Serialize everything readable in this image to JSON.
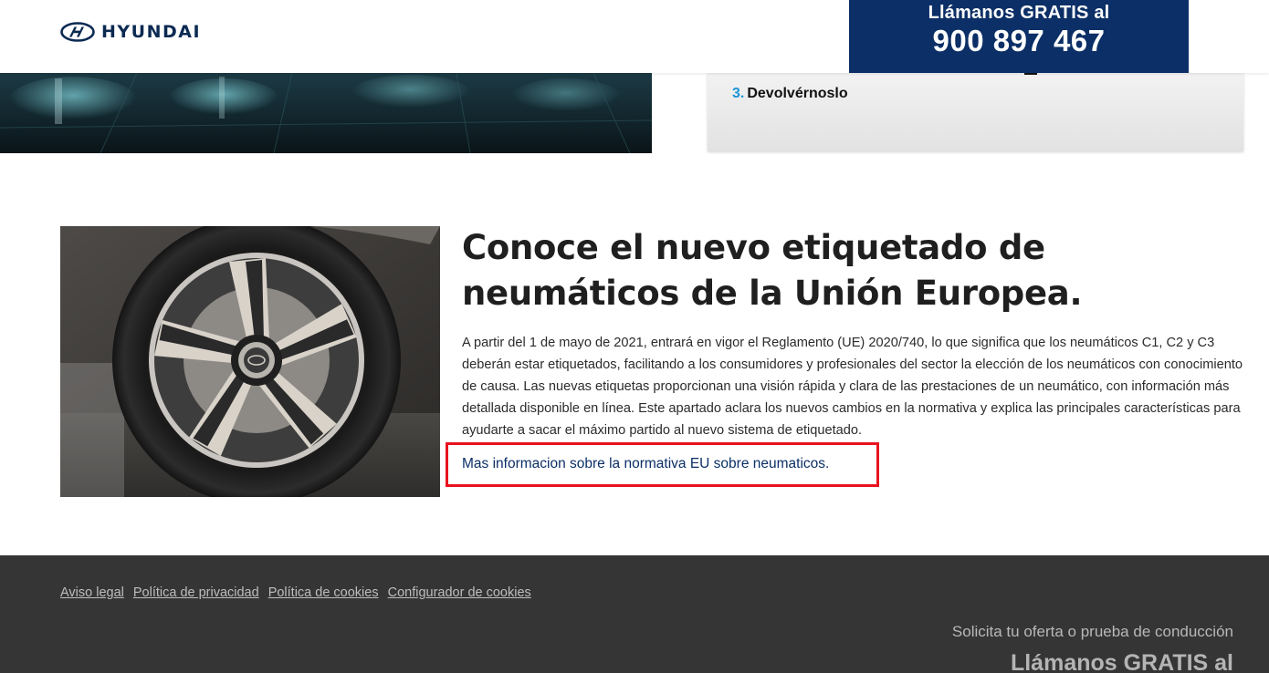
{
  "header": {
    "brand": "HYUNDAI",
    "call_label": "Llámanos GRATIS al",
    "call_phone": "900 897 467"
  },
  "steps": {
    "items": [
      {
        "number": "3.",
        "label": "Devolvérnoslo"
      }
    ],
    "accent_color": "#1b95d6"
  },
  "article": {
    "title": "Conoce el nuevo etiquetado de neumáticos de la Unión Europea.",
    "body": "A partir del 1 de mayo de 2021, entrará en vigor el Reglamento (UE) 2020/740, lo que significa que los neumáticos C1, C2 y C3 deberán estar etiquetados, facilitando a los consumidores y profesionales del sector la elección de los neumáticos con conocimiento de causa. Las nuevas etiquetas proporcionan una visión rápida y clara de las prestaciones de un neumático, con información más detallada disponible en línea. Este apartado aclara los nuevos cambios en la normativa y explica las principales características para ayudarte a sacar el máximo partido al nuevo sistema de etiquetado.",
    "more_link": "Mas informacion sobre la normativa EU sobre neumaticos.",
    "highlight_color": "#e8121e"
  },
  "footer": {
    "links": [
      "Aviso legal",
      "Política de privacidad",
      "Política de cookies",
      "Configurador de cookies"
    ],
    "cta": "Solicita tu oferta o prueba de conducción",
    "call_label": "Llámanos GRATIS al"
  },
  "colors": {
    "brand_navy": "#0b2f66",
    "footer_bg": "#353535"
  },
  "icons": {
    "logo": "hyundai-logo-icon"
  }
}
